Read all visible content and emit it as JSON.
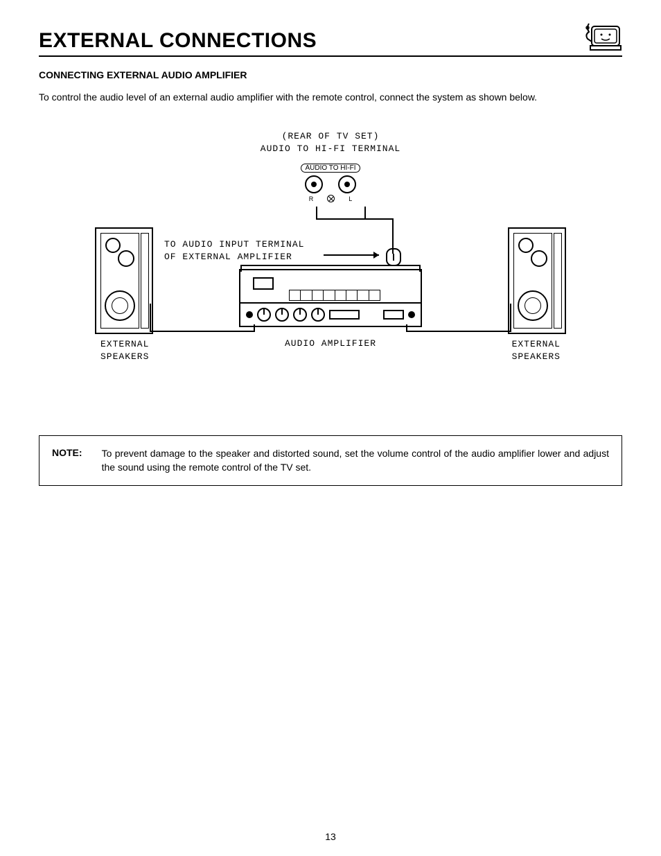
{
  "title": "EXTERNAL CONNECTIONS",
  "section_heading": "CONNECTING EXTERNAL AUDIO AMPLIFIER",
  "intro": "To control the audio level of an external audio amplifier with the remote control, connect the system as shown below.",
  "diagram": {
    "rear_line1": "(REAR OF TV SET)",
    "rear_line2": "AUDIO TO HI-FI TERMINAL",
    "hifi_tab": "AUDIO TO HI-FI",
    "jack_R": "R",
    "jack_L": "L",
    "to_input_line1": "TO AUDIO INPUT TERMINAL",
    "to_input_line2": "OF EXTERNAL AMPLIFIER",
    "amp_label": "AUDIO AMPLIFIER",
    "speaker_line1": "EXTERNAL",
    "speaker_line2": "SPEAKERS"
  },
  "note": {
    "label": "NOTE:",
    "text": "To prevent damage to the speaker and distorted sound, set the volume control of the audio amplifier lower and adjust the sound using the remote control of the TV set."
  },
  "page_number": "13"
}
